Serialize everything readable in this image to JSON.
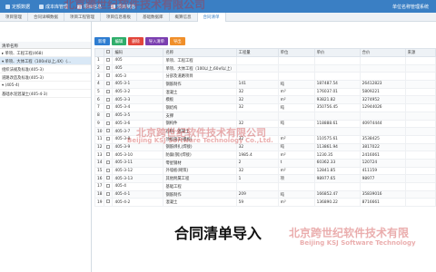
{
  "topbar": {
    "menu": [
      "定额数据",
      "成本库管理",
      "项目信息",
      "项目状态"
    ],
    "right": "单位名称管理系统"
  },
  "watermark_top": "北京跨世纪软件技术有限公司",
  "tabs": [
    "项目管理",
    "合同详细数据",
    "项目工程管理",
    "项目信息看板",
    "基础数据库",
    "概算信息",
    "合同清单"
  ],
  "left_header": "清单名称",
  "tree": [
    "▸ 单项、工程工程(468)",
    "▾ 单项、大体工程（100㎡以上,4X）(...",
    "   组织法规及标准(405-3)",
    "   道路改造及标准(405-3)",
    "▾ (405-4)",
    "   基础水泥混凝土(405-4-3)"
  ],
  "toolbar": [
    "新增",
    "编辑",
    "删除",
    "导入清单",
    "导出"
  ],
  "table": {
    "headers": [
      "",
      "",
      "编码",
      "名称",
      "工程量",
      "单位",
      "单价",
      "合价",
      "来源"
    ],
    "rows": [
      [
        "1",
        "405",
        "单项、工程工程",
        "",
        "",
        "",
        "",
        ""
      ],
      [
        "2",
        "405",
        "单项、大体工程（100以上,60㎡以上）",
        "",
        "",
        "",
        "",
        ""
      ],
      [
        "3",
        "405-3",
        "分部及道路项目",
        "",
        "",
        "",
        "",
        ""
      ],
      [
        "4",
        "405-3-1",
        "钢筋制作",
        "141",
        "吨",
        "187487.54",
        "26412823",
        ""
      ],
      [
        "5",
        "405-3-2",
        "混凝土",
        "32",
        "m³",
        "176037.01",
        "5809221",
        ""
      ],
      [
        "6",
        "405-3-3",
        "模板",
        "32",
        "m²",
        "93821.82",
        "3274952",
        ""
      ],
      [
        "7",
        "405-3-4",
        "钢结构",
        "32",
        "吨",
        "350756.45",
        "12944026",
        ""
      ],
      [
        "8",
        "405-3-5",
        "支撑",
        "",
        "",
        "",
        "",
        ""
      ],
      [
        "9",
        "405-3-6",
        "钢构件",
        "32",
        "吨",
        "118888.61",
        "40974444",
        ""
      ],
      [
        "10",
        "405-3-7",
        "石料、混凝土",
        "",
        "",
        "",
        "",
        ""
      ],
      [
        "11",
        "405-3-8",
        "顶板施工(模板)",
        "32",
        "m²",
        "110575.61",
        "3538425",
        ""
      ],
      [
        "12",
        "405-3-9",
        "钢筋绑扎(焊接)",
        "32",
        "吨",
        "113861.94",
        "3817022",
        ""
      ],
      [
        "13",
        "405-3-10",
        "防腐(钢)(焊接)",
        "1985.4",
        "m²",
        "1230.35",
        "2416061",
        ""
      ],
      [
        "14",
        "405-3-11",
        "零星钢材",
        "2",
        "t",
        "60362.33",
        "120724",
        ""
      ],
      [
        "15",
        "405-3-12",
        "外墙板(砌筑)",
        "32",
        "m²",
        "12841.85",
        "411159",
        ""
      ],
      [
        "16",
        "405-3-13",
        "其他附属工程",
        "1",
        "项",
        "98977.65",
        "98977",
        ""
      ],
      [
        "17",
        "405-4",
        "基础工程",
        "",
        "",
        "",
        "",
        ""
      ],
      [
        "18",
        "405-4-1",
        "钢筋制作",
        "209",
        "吨",
        "166852.47",
        "35839016",
        ""
      ],
      [
        "19",
        "405-4-2",
        "混凝土",
        "59",
        "m³",
        "136890.22",
        "8716661",
        ""
      ]
    ]
  },
  "watermark_mid_cn": "北京跨世纪软件技术有限公司",
  "watermark_mid_en": "Beijing KSJ Software Technology Co.,Ltd.",
  "watermark_br_cn": "北京跨世纪软件技术有限",
  "watermark_br_en": "Beijing KSJ Software Technology",
  "subtitle": "合同清单导入"
}
